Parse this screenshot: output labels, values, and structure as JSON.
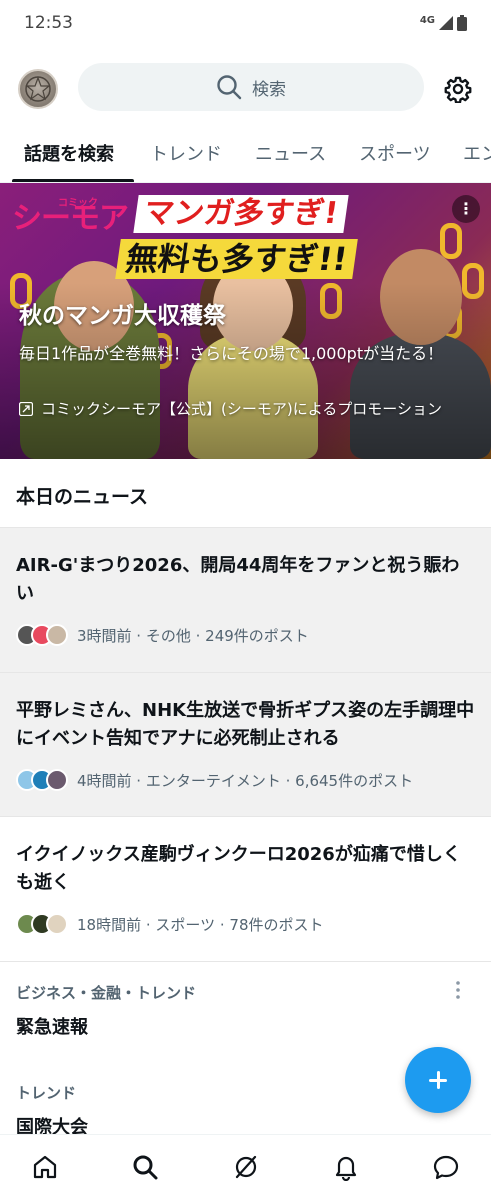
{
  "status_bar": {
    "time": "12:53",
    "network": "4G"
  },
  "header": {
    "search_placeholder": "検索",
    "settings_icon": "gear-icon",
    "avatar_icon": "avatar"
  },
  "tabs": [
    {
      "label": "話題を検索",
      "active": true
    },
    {
      "label": "トレンド",
      "active": false
    },
    {
      "label": "ニュース",
      "active": false
    },
    {
      "label": "スポーツ",
      "active": false
    },
    {
      "label": "エン",
      "active": false
    }
  ],
  "promo": {
    "brand": "シーモア",
    "brand_small": "コミック",
    "banner_line1": "マンガ多すぎ!",
    "banner_line2": "無料も多すぎ!!",
    "title": "秋のマンガ大収穫祭",
    "description": "毎日1作品が全巻無料！さらにその場で1,000ptが当たる！",
    "sponsor": "コミックシーモア【公式】(シーモア)によるプロモーション"
  },
  "news_section": {
    "heading": "本日のニュース",
    "items": [
      {
        "title": "AIR-G'まつり2026、開局44周年をファンと祝う賑わい",
        "meta": "3時間前 · その他 · 249件のポスト"
      },
      {
        "title": "平野レミさん、NHK生放送で骨折ギプス姿の左手調理中にイベント告知でアナに必死制止される",
        "meta": "4時間前 · エンターテイメント · 6,645件のポスト"
      },
      {
        "title": "イクイノックス産駒ヴィンクーロ2026が疝痛で惜しくも逝く",
        "meta": "18時間前 · スポーツ · 78件のポスト"
      }
    ]
  },
  "trends": [
    {
      "category": "ビジネス・金融・トレンド",
      "name": "緊急速報"
    },
    {
      "category": "トレンド",
      "name": "国際大会"
    }
  ],
  "colors": {
    "accent": "#1d9bf0",
    "text": "#0f1419",
    "secondary": "#536471"
  }
}
